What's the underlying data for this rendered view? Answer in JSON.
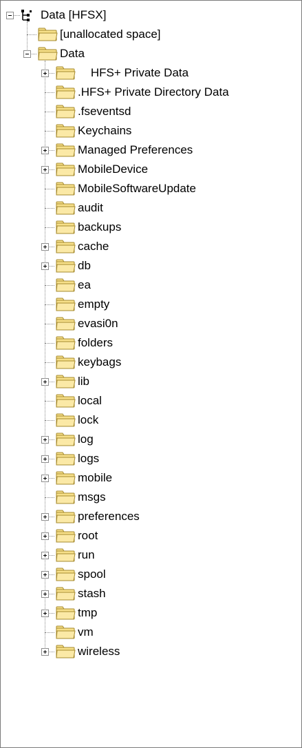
{
  "tree": {
    "root": {
      "label": "Data [HFSX]",
      "icon": "evidence-tree-icon",
      "expanded": true
    },
    "top_children": [
      {
        "label": "[unallocated space]",
        "icon": "folder-icon",
        "has_children": false
      },
      {
        "label": "Data",
        "icon": "folder-icon",
        "has_children": true,
        "expanded": true
      }
    ],
    "data_children": [
      {
        "label": "    HFS+ Private Data",
        "has_children": true
      },
      {
        "label": ".HFS+ Private Directory Data",
        "has_children": false
      },
      {
        "label": ".fseventsd",
        "has_children": false
      },
      {
        "label": "Keychains",
        "has_children": false
      },
      {
        "label": "Managed Preferences",
        "has_children": true
      },
      {
        "label": "MobileDevice",
        "has_children": true
      },
      {
        "label": "MobileSoftwareUpdate",
        "has_children": false
      },
      {
        "label": "audit",
        "has_children": false
      },
      {
        "label": "backups",
        "has_children": false
      },
      {
        "label": "cache",
        "has_children": true
      },
      {
        "label": "db",
        "has_children": true
      },
      {
        "label": "ea",
        "has_children": false
      },
      {
        "label": "empty",
        "has_children": false
      },
      {
        "label": "evasi0n",
        "has_children": false
      },
      {
        "label": "folders",
        "has_children": false
      },
      {
        "label": "keybags",
        "has_children": false
      },
      {
        "label": "lib",
        "has_children": true
      },
      {
        "label": "local",
        "has_children": false
      },
      {
        "label": "lock",
        "has_children": false
      },
      {
        "label": "log",
        "has_children": true
      },
      {
        "label": "logs",
        "has_children": true
      },
      {
        "label": "mobile",
        "has_children": true
      },
      {
        "label": "msgs",
        "has_children": false
      },
      {
        "label": "preferences",
        "has_children": true
      },
      {
        "label": "root",
        "has_children": true
      },
      {
        "label": "run",
        "has_children": true
      },
      {
        "label": "spool",
        "has_children": true
      },
      {
        "label": "stash",
        "has_children": true
      },
      {
        "label": "tmp",
        "has_children": true
      },
      {
        "label": "vm",
        "has_children": false
      },
      {
        "label": "wireless",
        "has_children": true
      }
    ]
  },
  "colors": {
    "folder_fill": "#f7e08a",
    "folder_front": "#fbe9a6",
    "folder_stroke": "#a68a2e",
    "tree_lines": "#8a8a8a",
    "border": "#7a7a7a"
  }
}
